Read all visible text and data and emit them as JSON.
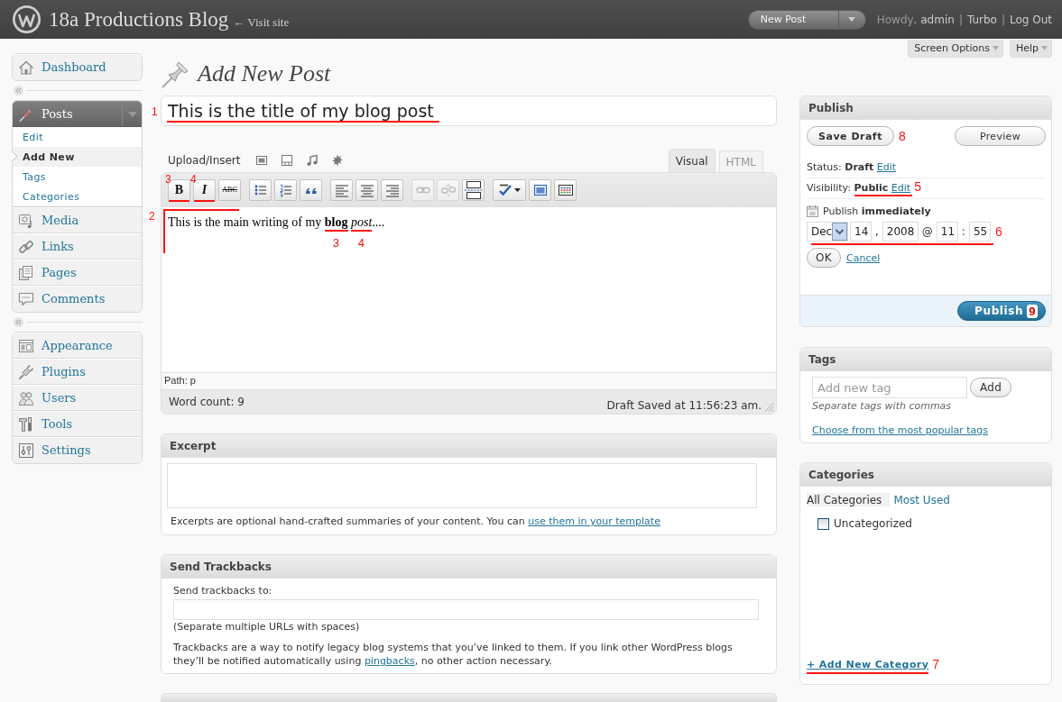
{
  "header": {
    "site_title": "18a Productions Blog",
    "visit_site": "← Visit site",
    "new_post": "New Post",
    "greeting": "Howdy,",
    "links": [
      "admin",
      "Turbo",
      "Log Out"
    ],
    "separator": "|"
  },
  "screen_meta": {
    "tabs": [
      "Screen Options",
      "Help"
    ]
  },
  "sidebar": {
    "groups": [
      {
        "items": [
          {
            "label": "Dashboard",
            "selected": false
          }
        ]
      },
      {
        "items": [
          {
            "label": "Posts",
            "selected": true,
            "children": [
              {
                "label": "Edit",
                "selected": false
              },
              {
                "label": "Add New",
                "selected": true
              },
              {
                "label": "Tags",
                "selected": false
              },
              {
                "label": "Categories",
                "selected": false
              }
            ]
          },
          {
            "label": "Media",
            "selected": false
          },
          {
            "label": "Links",
            "selected": false
          },
          {
            "label": "Pages",
            "selected": false
          },
          {
            "label": "Comments",
            "selected": false
          }
        ]
      },
      {
        "items": [
          {
            "label": "Appearance",
            "selected": false
          },
          {
            "label": "Plugins",
            "selected": false
          },
          {
            "label": "Users",
            "selected": false
          },
          {
            "label": "Tools",
            "selected": false
          },
          {
            "label": "Settings",
            "selected": false
          }
        ]
      }
    ]
  },
  "page_title": "Add New Post",
  "post_title": {
    "value": "This is the title of my blog post",
    "annotation": {
      "label": "1",
      "kind": "underline"
    }
  },
  "editor": {
    "upload_label": "Upload/Insert",
    "tabs": [
      {
        "label": "Visual",
        "selected": true
      },
      {
        "label": "HTML",
        "selected": false
      }
    ],
    "toolbar": [
      {
        "buttons": [
          {
            "kind": "bold",
            "label": "B",
            "disabled": false,
            "annotation": {
              "label": "3",
              "kind": "underline"
            }
          },
          {
            "kind": "italic",
            "label": "I",
            "disabled": false,
            "annotation": {
              "label": "4",
              "kind": "underline"
            }
          },
          {
            "kind": "strike",
            "label": "ABC",
            "disabled": false
          }
        ]
      },
      {
        "buttons": [
          {
            "kind": "icon",
            "disabled": false
          },
          {
            "kind": "icon",
            "disabled": false
          },
          {
            "kind": "icon",
            "disabled": false
          }
        ]
      },
      {
        "buttons": [
          {
            "kind": "icon",
            "disabled": false
          },
          {
            "kind": "icon",
            "disabled": false
          },
          {
            "kind": "icon",
            "disabled": false
          }
        ]
      },
      {
        "buttons": [
          {
            "kind": "icon",
            "disabled": true
          },
          {
            "kind": "icon",
            "disabled": true
          },
          {
            "kind": "icon",
            "disabled": false
          }
        ]
      },
      {
        "buttons": [
          {
            "kind": "split",
            "disabled": false
          },
          {
            "kind": "icon",
            "disabled": false
          },
          {
            "kind": "icon",
            "disabled": false
          }
        ]
      }
    ],
    "content": "This is the main writing of my **blog** *post*....",
    "content_marks": [
      {
        "label": "3",
        "kind": "underline"
      },
      {
        "label": "4",
        "kind": "underline"
      }
    ],
    "annotation": {
      "label": "2",
      "kind": "bracket"
    },
    "path": "Path: p",
    "word_count": "Word count: 9",
    "draft_saved": "Draft Saved at 11:56:23 am."
  },
  "excerpt": {
    "title": "Excerpt",
    "note": "Excerpts are optional hand-crafted summaries of your content. You can",
    "note_link": "use them in your template"
  },
  "trackbacks": {
    "title": "Send Trackbacks",
    "label": "Send trackbacks to:",
    "hint": "(Separate multiple URLs with spaces)",
    "note": "Trackbacks are a way to notify legacy blog systems that you’ve linked to them. If you link other WordPress blogs they’ll be notified automatically using",
    "note_link": "pingbacks",
    "note_end": ", no other action necessary."
  },
  "publish": {
    "title": "Publish",
    "save_draft": {
      "label": "Save Draft",
      "annotation": {
        "label": "8",
        "kind": "number"
      }
    },
    "preview": "Preview",
    "status": {
      "label": "Status:",
      "value": "Draft",
      "link": "Edit"
    },
    "visibility": {
      "label": "Visibility:",
      "value": "Public",
      "link": "Edit",
      "annotation": {
        "label": "5",
        "kind": "underline"
      }
    },
    "schedule": "Publish **immediately**",
    "date": {
      "parts": [
        {
          "kind": "select",
          "value": "Dec"
        },
        {
          "kind": "input",
          "value": "14"
        },
        {
          "kind": "text",
          "value": ","
        },
        {
          "kind": "input",
          "value": "2008"
        },
        {
          "kind": "text",
          "value": "@"
        },
        {
          "kind": "input",
          "value": "11"
        },
        {
          "kind": "text",
          "value": ":"
        },
        {
          "kind": "input",
          "value": "55"
        }
      ],
      "annotation": {
        "label": "6",
        "kind": "underline"
      }
    },
    "ok": "OK",
    "cancel": "Cancel",
    "publish_button": {
      "label": "Publish",
      "annotation": {
        "label": "9",
        "kind": "number"
      }
    }
  },
  "tags": {
    "title": "Tags",
    "placeholder": "Add new tag",
    "add": "Add",
    "hint": "Separate tags with commas",
    "popular_link": "Choose from the most popular tags"
  },
  "categories": {
    "title": "Categories",
    "tabs": [
      {
        "label": "All Categories",
        "selected": true
      },
      {
        "label": "Most Used",
        "selected": false
      }
    ],
    "items": [
      {
        "label": "Uncategorized",
        "checked": false
      }
    ],
    "add_link": {
      "label": "+ Add New Category",
      "annotation": {
        "label": "7",
        "kind": "underline"
      }
    }
  }
}
